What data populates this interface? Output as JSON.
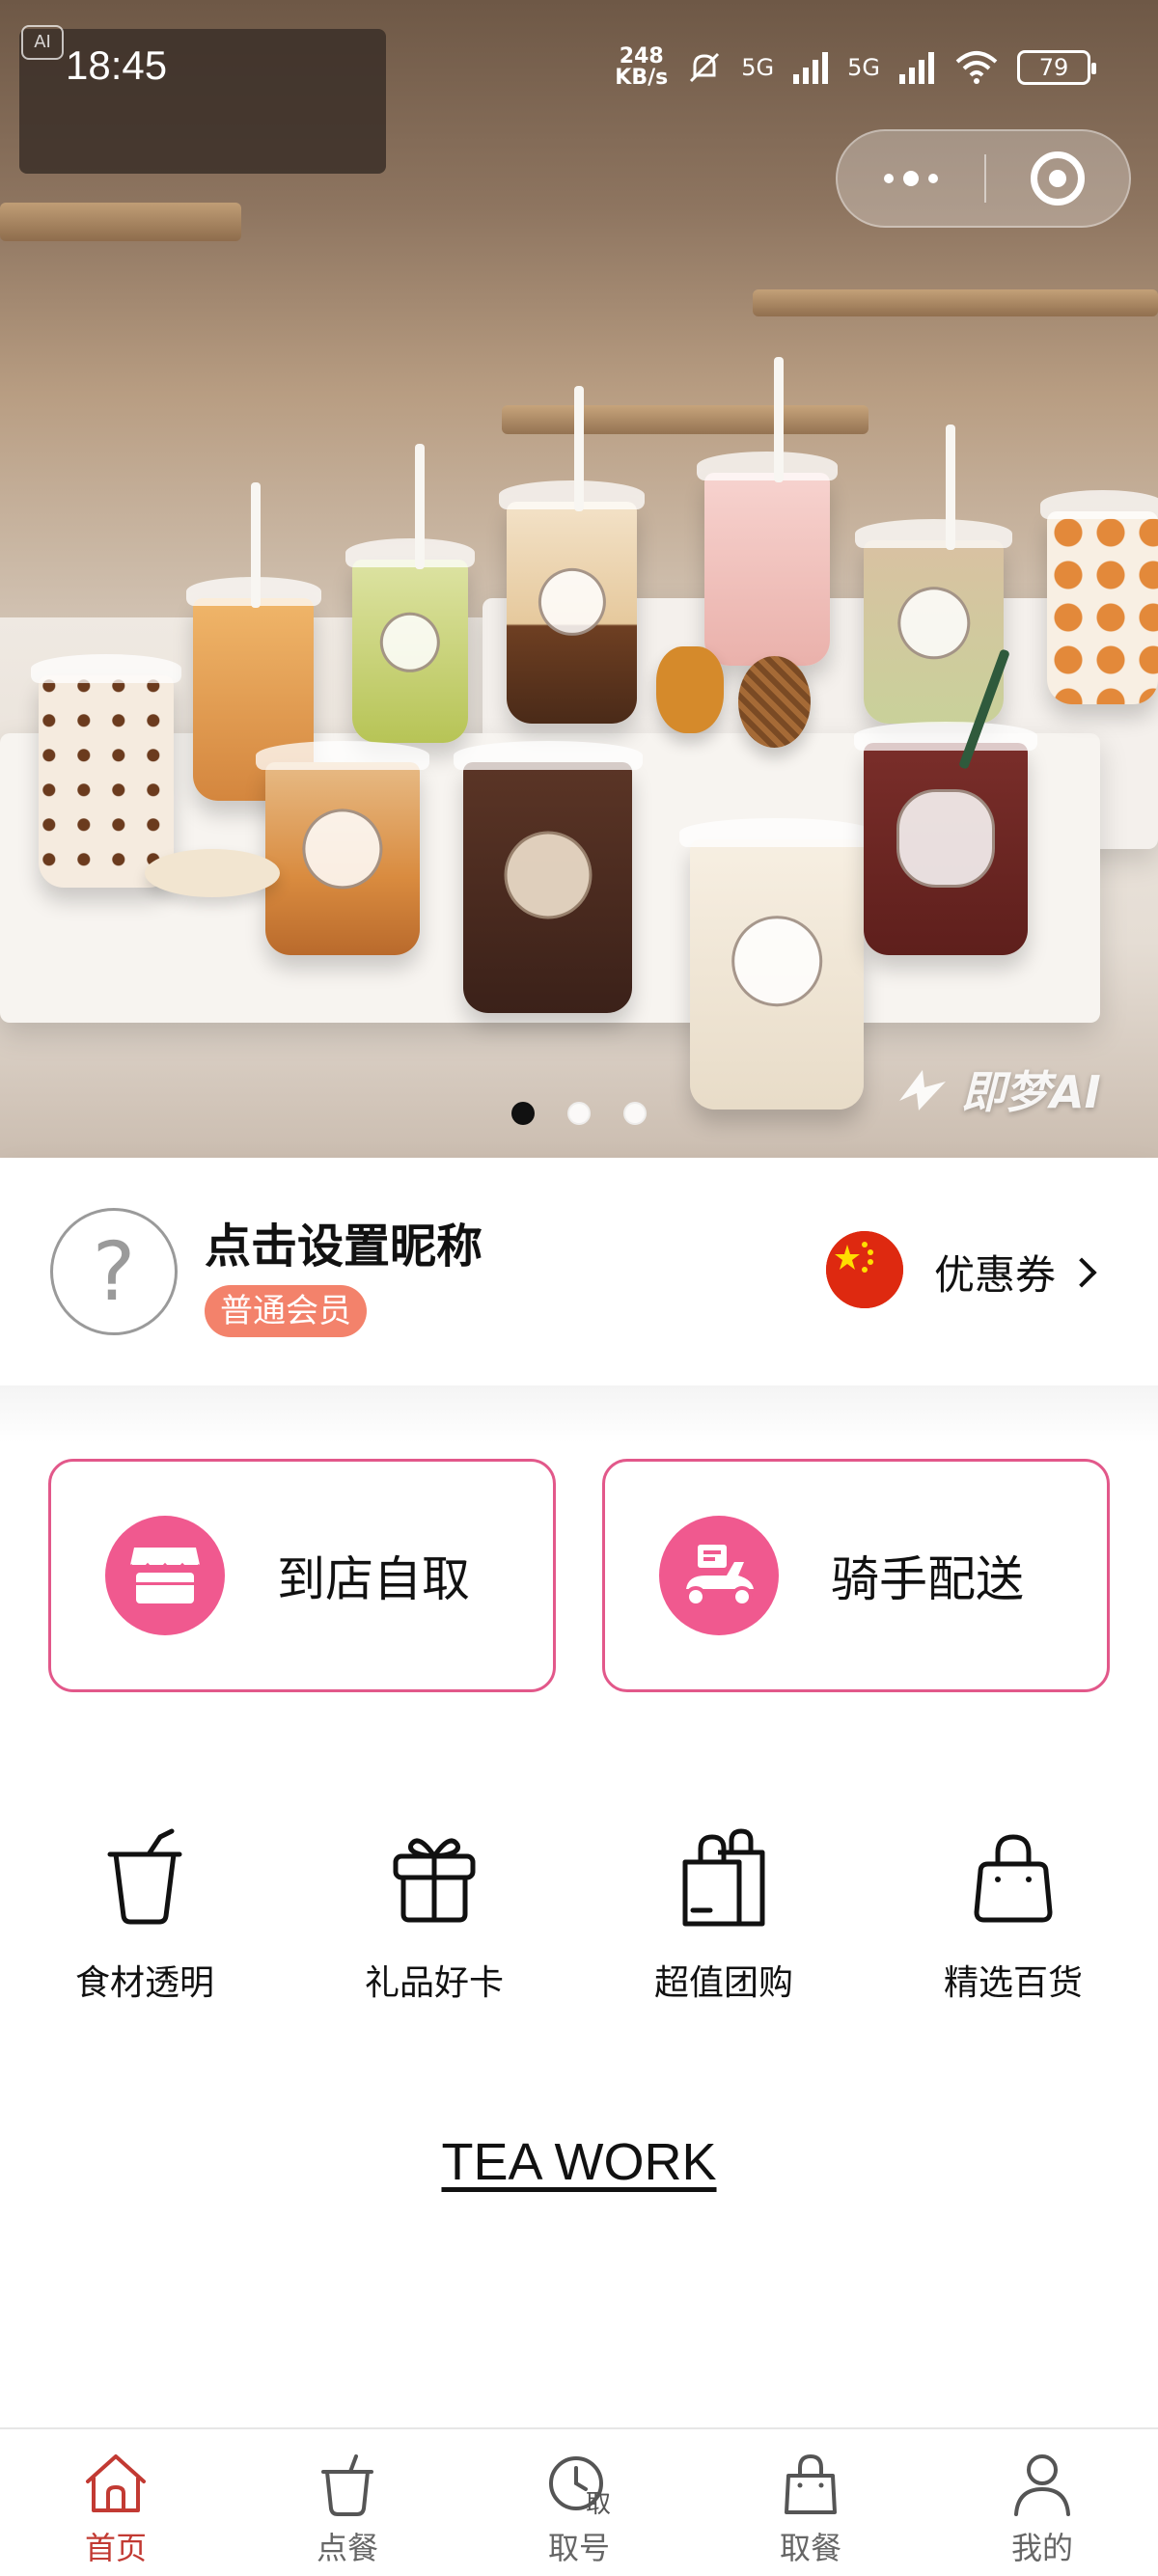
{
  "status_bar": {
    "time": "18:45",
    "net_speed_value": "248",
    "net_speed_unit": "KB/s",
    "signal_1": "5G",
    "signal_2": "5G",
    "battery": "79"
  },
  "hero": {
    "carousel_dots": 3,
    "active_dot": 0,
    "watermark": "即梦AI"
  },
  "profile": {
    "avatar_placeholder": "?",
    "nickname": "点击设置昵称",
    "member_level": "普通会员",
    "coupon_label": "优惠券"
  },
  "order_modes": [
    {
      "label": "到店自取",
      "icon": "store-icon"
    },
    {
      "label": "骑手配送",
      "icon": "scooter-icon"
    }
  ],
  "quick_links": [
    {
      "label": "食材透明",
      "icon": "drink-cup-icon"
    },
    {
      "label": "礼品好卡",
      "icon": "gift-icon"
    },
    {
      "label": "超值团购",
      "icon": "shopping-bags-icon"
    },
    {
      "label": "精选百货",
      "icon": "handbag-icon"
    }
  ],
  "brand_link": "TEA WORK",
  "tabbar": {
    "active_index": 0,
    "accent_color": "#c23a33",
    "items": [
      {
        "label": "首页",
        "icon": "home-icon"
      },
      {
        "label": "点餐",
        "icon": "cup-icon"
      },
      {
        "label": "取号",
        "icon": "clock-ticket-icon"
      },
      {
        "label": "取餐",
        "icon": "bag-icon"
      },
      {
        "label": "我的",
        "icon": "user-icon"
      }
    ]
  },
  "colors": {
    "primary_pink": "#f0598f",
    "card_border": "#e2588a",
    "member_badge": "#f3826b"
  }
}
